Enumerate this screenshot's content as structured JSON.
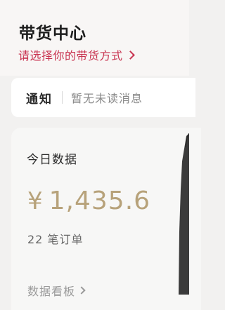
{
  "header": {
    "title": "带货中心",
    "subtitle_link": "请选择你的带货方式"
  },
  "notice": {
    "label": "通知",
    "message": "暂无未读消息"
  },
  "stats": {
    "title": "今日数据",
    "currency_symbol": "¥",
    "amount": "1,435.6",
    "orders": "22 笔订单",
    "review_link": "数据看板"
  },
  "colors": {
    "accent_red": "#c8324f",
    "amount_gold": "#b7a27a"
  }
}
